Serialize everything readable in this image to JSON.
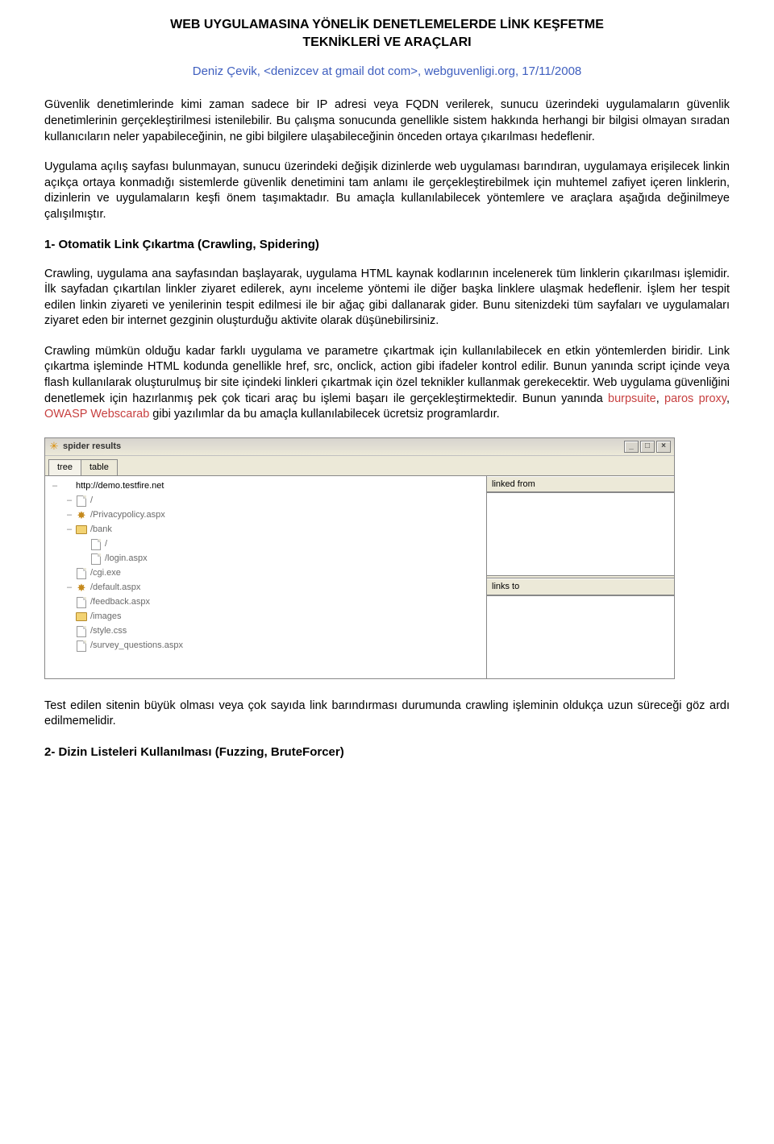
{
  "doc": {
    "title_line1": "WEB UYGULAMASINA YÖNELİK DENETLEMELERDE LİNK KEŞFETME",
    "title_line2": "TEKNİKLERİ VE ARAÇLARI",
    "byline": "Deniz Çevik, <denizcev at gmail dot com>, webguvenligi.org, 17/11/2008",
    "p1": "Güvenlik denetimlerinde kimi zaman sadece bir IP adresi veya FQDN verilerek, sunucu üzerindeki uygulamaların güvenlik denetimlerinin gerçekleştirilmesi istenilebilir. Bu çalışma sonucunda genellikle sistem hakkında herhangi bir bilgisi olmayan sıradan kullanıcıların neler yapabileceğinin, ne gibi bilgilere ulaşabileceğinin önceden ortaya çıkarılması hedeflenir.",
    "p2": "Uygulama açılış sayfası bulunmayan, sunucu üzerindeki değişik dizinlerde web uygulaması barındıran, uygulamaya erişilecek linkin açıkça ortaya konmadığı sistemlerde güvenlik denetimini tam anlamı ile gerçekleştirebilmek için muhtemel zafiyet içeren linklerin, dizinlerin ve uygulamaların keşfi önem taşımaktadır. Bu amaçla kullanılabilecek yöntemlere ve araçlara aşağıda değinilmeye çalışılmıştır.",
    "h1": "1- Otomatik Link Çıkartma (Crawling, Spidering)",
    "p3": "Crawling, uygulama ana sayfasından başlayarak, uygulama HTML kaynak kodlarının incelenerek tüm linklerin çıkarılması işlemidir. İlk sayfadan çıkartılan linkler ziyaret edilerek, aynı inceleme yöntemi ile diğer başka linklere ulaşmak hedeflenir. İşlem her tespit edilen linkin ziyareti ve yenilerinin tespit edilmesi ile bir ağaç gibi dallanarak gider. Bunu sitenizdeki tüm sayfaları ve uygulamaları ziyaret eden bir internet gezginin oluşturduğu aktivite olarak düşünebilirsiniz.",
    "p4_pre": "Crawling mümkün olduğu kadar farklı uygulama ve parametre çıkartmak için kullanılabilecek en etkin yöntemlerden biridir. Link çıkartma işleminde HTML kodunda genellikle href, src, onclick, action gibi ifadeler kontrol edilir. Bunun yanında script içinde veya flash kullanılarak oluşturulmuş bir site içindeki linkleri çıkartmak için özel teknikler kullanmak gerekecektir. Web uygulama güvenliğini denetlemek için hazırlanmış pek çok ticari araç bu işlemi başarı ile gerçekleştirmektedir. Bunun yanında ",
    "link1": "burpsuite",
    "sep1": ", ",
    "link2": "paros proxy",
    "sep2": ", ",
    "link3": "OWASP Webscarab",
    "p4_post": " gibi yazılımlar da bu amaçla kullanılabilecek ücretsiz programlardır.",
    "p5": "Test edilen sitenin büyük olması veya çok sayıda link barındırması durumunda crawling işleminin oldukça uzun süreceği göz ardı edilmemelidir.",
    "h2": "2- Dizin Listeleri Kullanılması (Fuzzing, BruteForcer)"
  },
  "spider": {
    "window_title": "spider results",
    "tabs": {
      "tree": "tree",
      "table": "table"
    },
    "right": {
      "linked_from": "linked from",
      "links_to": "links to"
    },
    "winbtn": {
      "min": "_",
      "max": "□",
      "close": "×"
    },
    "tree": [
      {
        "depth": 0,
        "handle": "–",
        "icon": "none",
        "label": "http://demo.testfire.net",
        "root": true
      },
      {
        "depth": 1,
        "handle": "–",
        "icon": "file",
        "label": "/"
      },
      {
        "depth": 1,
        "handle": "–",
        "icon": "gear",
        "label": "/Privacypolicy.aspx"
      },
      {
        "depth": 1,
        "handle": "–",
        "icon": "folder",
        "label": "/bank"
      },
      {
        "depth": 2,
        "handle": "",
        "icon": "file",
        "label": "/"
      },
      {
        "depth": 2,
        "handle": "",
        "icon": "file",
        "label": "/login.aspx"
      },
      {
        "depth": 1,
        "handle": "",
        "icon": "file",
        "label": "/cgi.exe"
      },
      {
        "depth": 1,
        "handle": "–",
        "icon": "gear",
        "label": "/default.aspx"
      },
      {
        "depth": 1,
        "handle": "",
        "icon": "file",
        "label": "/feedback.aspx"
      },
      {
        "depth": 1,
        "handle": "",
        "icon": "folder",
        "label": "/images"
      },
      {
        "depth": 1,
        "handle": "",
        "icon": "file",
        "label": "/style.css"
      },
      {
        "depth": 1,
        "handle": "",
        "icon": "file",
        "label": "/survey_questions.aspx"
      }
    ]
  }
}
